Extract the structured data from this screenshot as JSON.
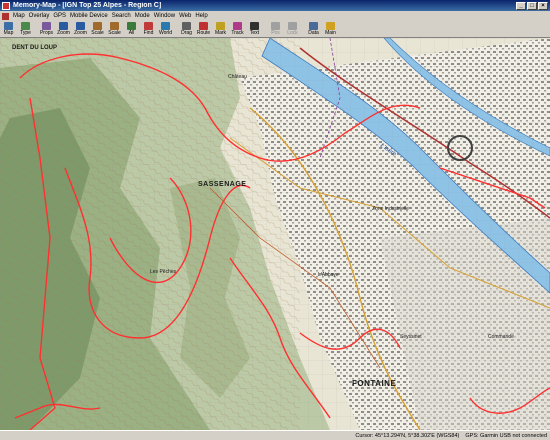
{
  "window": {
    "title": "Memory-Map - [IGN Top 25 Alpes - Region C]"
  },
  "menu": [
    "Map",
    "Overlay",
    "GPS",
    "Mobile Device",
    "Search",
    "Mode",
    "Window",
    "Web",
    "Help"
  ],
  "toolbar": [
    {
      "label": "Map",
      "icon": "map-icon",
      "color": "#3a6ea5",
      "enabled": true
    },
    {
      "label": "Type",
      "icon": "type-icon",
      "color": "#4a8a4a",
      "enabled": true
    },
    {
      "label": "Props",
      "icon": "props-icon",
      "color": "#7a5a9a",
      "enabled": true
    },
    {
      "label": "Zoom",
      "icon": "zoom-in-icon",
      "color": "#2a5aa0",
      "enabled": true
    },
    {
      "label": "Zoom",
      "icon": "zoom-out-icon",
      "color": "#2a5aa0",
      "enabled": true
    },
    {
      "label": "Scale",
      "icon": "scale-icon",
      "color": "#a06a2a",
      "enabled": true
    },
    {
      "label": "Scale",
      "icon": "scale-down-icon",
      "color": "#a06a2a",
      "enabled": true
    },
    {
      "label": "All",
      "icon": "all-icon",
      "color": "#3a7a3a",
      "enabled": true
    },
    {
      "label": "Find",
      "icon": "find-icon",
      "color": "#c03a3a",
      "enabled": true
    },
    {
      "label": "World",
      "icon": "world-icon",
      "color": "#2a7ab0",
      "enabled": true
    },
    {
      "label": "Drag",
      "icon": "drag-icon",
      "color": "#606060",
      "enabled": true
    },
    {
      "label": "Route",
      "icon": "route-icon",
      "color": "#c03030",
      "enabled": true
    },
    {
      "label": "Mark",
      "icon": "mark-icon",
      "color": "#c0a020",
      "enabled": true
    },
    {
      "label": "Track",
      "icon": "track-icon",
      "color": "#b03a8a",
      "enabled": true
    },
    {
      "label": "Text",
      "icon": "text-icon",
      "color": "#303030",
      "enabled": true
    },
    {
      "label": "Pos",
      "icon": "position-icon",
      "color": "#a0a0a0",
      "enabled": false
    },
    {
      "label": "Lock",
      "icon": "lock-icon",
      "color": "#a0a0a0",
      "enabled": false
    },
    {
      "label": "Data",
      "icon": "data-icon",
      "color": "#4a6a9a",
      "enabled": true
    },
    {
      "label": "Main",
      "icon": "main-icon",
      "color": "#d0a020",
      "enabled": true
    }
  ],
  "map": {
    "labels": {
      "dent": "DENT DU LOUP",
      "sassenage": "SASSENAGE",
      "fontaine": "FONTAINE",
      "chateau": "Château",
      "peches": "Les Pêches",
      "seyssinet": "Seyssinet",
      "isere": "L'Isère",
      "zone_ind": "Zone Industrielle",
      "abbaye": "L'Abbaye",
      "commande": "Commande"
    }
  },
  "status": {
    "cursor": "Cursor: 45°13.294'N, 5°38.302'E (WGS84)",
    "gps": "GPS: Garmin USB not connected"
  }
}
